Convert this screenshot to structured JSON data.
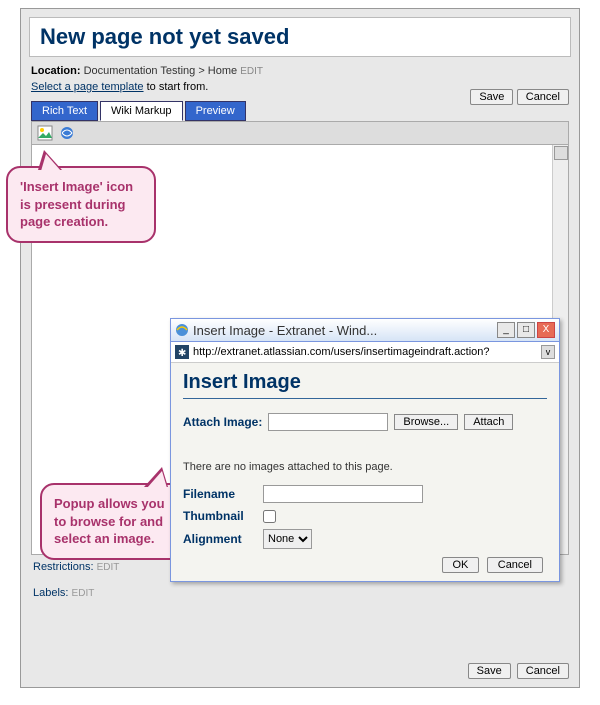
{
  "page": {
    "title": "New page not yet saved",
    "location_label": "Location:",
    "location_value": "Documentation Testing > Home",
    "location_edit": "EDIT",
    "template_link": "Select a page template",
    "template_rest": " to start from."
  },
  "tabs": {
    "rich": "Rich Text",
    "wiki": "Wiki Markup",
    "preview": "Preview"
  },
  "buttons": {
    "save": "Save",
    "cancel": "Cancel",
    "ok": "OK",
    "browse": "Browse...",
    "attach": "Attach"
  },
  "callouts": {
    "c1": "'Insert Image' icon is present during page creation.",
    "c2": "Popup allows you to browse for and select an image."
  },
  "popup": {
    "window_title": "Insert Image - Extranet - Wind...",
    "url": "http://extranet.atlassian.com/users/insertimageindraft.action?",
    "heading": "Insert Image",
    "attach_label": "Attach Image:",
    "no_images": "There are no images attached to this page.",
    "filename_label": "Filename",
    "thumbnail_label": "Thumbnail",
    "alignment_label": "Alignment",
    "alignment_value": "None"
  },
  "bottom": {
    "restrictions": "Restrictions:",
    "labels": "Labels:",
    "edit": "EDIT"
  }
}
